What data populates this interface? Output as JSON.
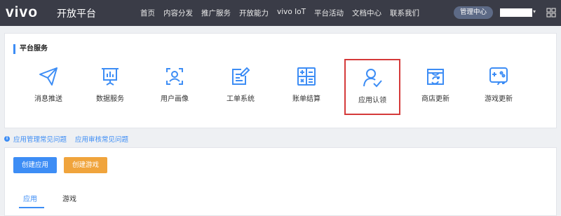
{
  "header": {
    "logo": "vivo",
    "title": "开放平台",
    "nav": [
      "首页",
      "内容分发",
      "推广服务",
      "开放能力",
      "vivo IoT",
      "平台活动",
      "文档中心",
      "联系我们"
    ],
    "admin_button": "管理中心"
  },
  "services": {
    "title": "平台服务",
    "items": [
      {
        "label": "消息推送",
        "icon": "paper-plane-icon"
      },
      {
        "label": "数据服务",
        "icon": "presentation-chart-icon"
      },
      {
        "label": "用户画像",
        "icon": "user-scan-icon"
      },
      {
        "label": "工单系统",
        "icon": "edit-document-icon"
      },
      {
        "label": "账单结算",
        "icon": "calculator-icon"
      },
      {
        "label": "应用认领",
        "icon": "user-check-icon"
      },
      {
        "label": "商店更新",
        "icon": "store-refresh-icon"
      },
      {
        "label": "游戏更新",
        "icon": "gamepad-refresh-icon"
      }
    ],
    "selected": "应用认领"
  },
  "help_links": [
    "应用管理常见问题",
    "应用审核常见问题"
  ],
  "apps_panel": {
    "create_app": "创建应用",
    "create_game": "创建游戏",
    "tabs": [
      "应用",
      "游戏"
    ],
    "active_tab": "应用"
  },
  "colors": {
    "topbar": "#3a3c47",
    "accent": "#3d8df5",
    "orange": "#f0a43c",
    "highlight": "#d53a3a"
  }
}
